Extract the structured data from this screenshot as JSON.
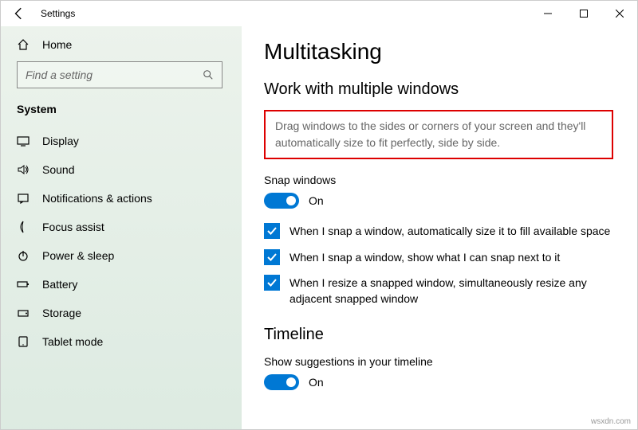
{
  "window": {
    "title": "Settings"
  },
  "sidebar": {
    "home": "Home",
    "search_placeholder": "Find a setting",
    "section": "System",
    "items": [
      {
        "label": "Display"
      },
      {
        "label": "Sound"
      },
      {
        "label": "Notifications & actions"
      },
      {
        "label": "Focus assist"
      },
      {
        "label": "Power & sleep"
      },
      {
        "label": "Battery"
      },
      {
        "label": "Storage"
      },
      {
        "label": "Tablet mode"
      }
    ]
  },
  "main": {
    "title": "Multitasking",
    "section1": {
      "heading": "Work with multiple windows",
      "description": "Drag windows to the sides or corners of your screen and they'll automatically size to fit perfectly, side by side.",
      "snap_label": "Snap windows",
      "snap_state": "On",
      "checks": [
        "When I snap a window, automatically size it to fill available space",
        "When I snap a window, show what I can snap next to it",
        "When I resize a snapped window, simultaneously resize any adjacent snapped window"
      ]
    },
    "section2": {
      "heading": "Timeline",
      "suggestions_label": "Show suggestions in your timeline",
      "suggestions_state": "On"
    }
  },
  "watermark": "wsxdn.com"
}
